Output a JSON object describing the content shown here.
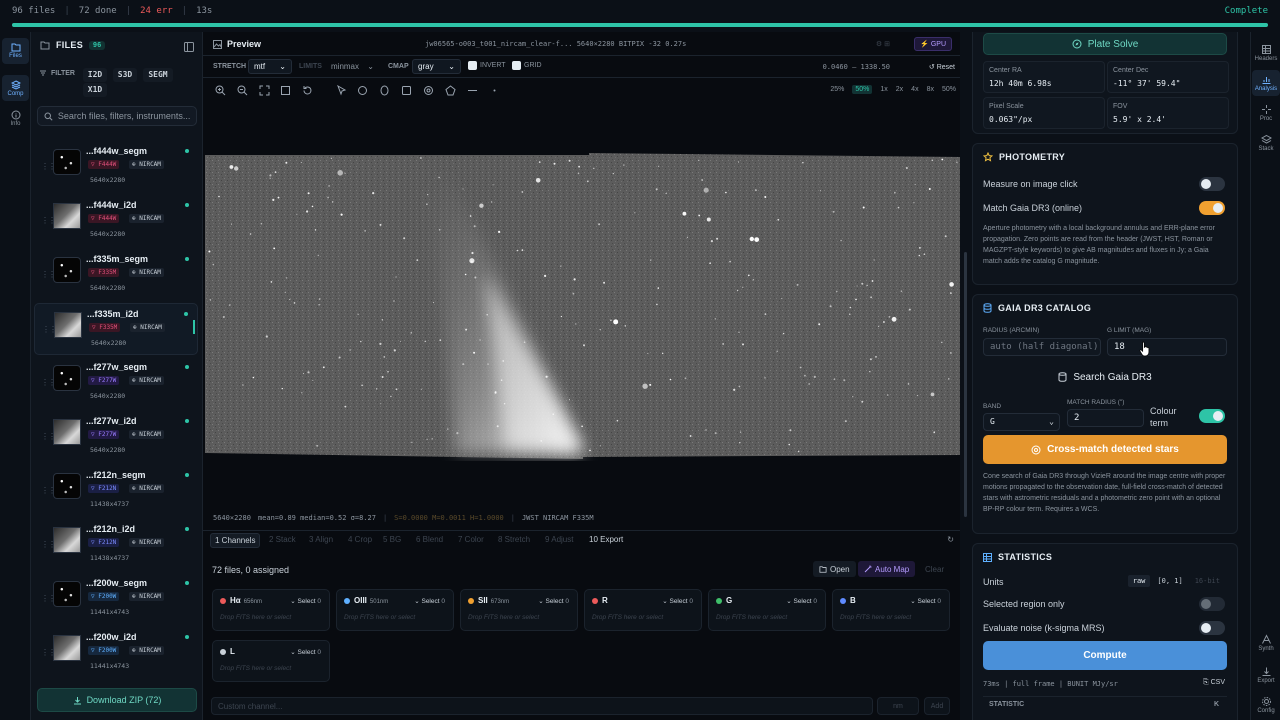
{
  "topbar": {
    "files": "96 files",
    "done": "72 done",
    "err": "24 err",
    "time": "13s",
    "status": "Complete",
    "progress": 1.0
  },
  "left_nav": [
    {
      "label": "Files",
      "icon": "folder-icon"
    },
    {
      "label": "Comp",
      "icon": "layers-icon"
    },
    {
      "label": "Info",
      "icon": "info-icon"
    }
  ],
  "files_panel": {
    "title": "FILES",
    "count": "96",
    "filter_label": "FILTER",
    "filters": [
      "I2D",
      "S3D",
      "SEGM",
      "X1D"
    ],
    "search_placeholder": "Search files, filters, instruments...",
    "items": [
      {
        "name": "...f444w_segm",
        "filter": "F444W",
        "instrument": "NIRCAM",
        "dims": "5640x2280",
        "thumb": "field",
        "color": "#e0507a",
        "bg": "#3a1624"
      },
      {
        "name": "...f444w_i2d",
        "filter": "F444W",
        "instrument": "NIRCAM",
        "dims": "5640x2280",
        "thumb": "smear",
        "color": "#e0507a",
        "bg": "#3a1624"
      },
      {
        "name": "...f335m_segm",
        "filter": "F335M",
        "instrument": "NIRCAM",
        "dims": "5640x2280",
        "thumb": "field",
        "color": "#e0507a",
        "bg": "#3a1624"
      },
      {
        "name": "...f335m_i2d",
        "filter": "F335M",
        "instrument": "NIRCAM",
        "dims": "5640x2280",
        "thumb": "smear",
        "color": "#e0507a",
        "bg": "#3a1624"
      },
      {
        "name": "...f277w_segm",
        "filter": "F277W",
        "instrument": "NIRCAM",
        "dims": "5640x2280",
        "thumb": "field",
        "color": "#9a7bff",
        "bg": "#221a44"
      },
      {
        "name": "...f277w_i2d",
        "filter": "F277W",
        "instrument": "NIRCAM",
        "dims": "5640x2280",
        "thumb": "smear",
        "color": "#9a7bff",
        "bg": "#221a44"
      },
      {
        "name": "...f212n_segm",
        "filter": "F212N",
        "instrument": "NIRCAM",
        "dims": "11438x4737",
        "thumb": "field",
        "color": "#7b8bff",
        "bg": "#1a1f44"
      },
      {
        "name": "...f212n_i2d",
        "filter": "F212N",
        "instrument": "NIRCAM",
        "dims": "11438x4737",
        "thumb": "smear",
        "color": "#7b8bff",
        "bg": "#1a1f44"
      },
      {
        "name": "...f200w_segm",
        "filter": "F200W",
        "instrument": "NIRCAM",
        "dims": "11441x4743",
        "thumb": "field",
        "color": "#5fb0ff",
        "bg": "#16283e"
      },
      {
        "name": "...f200w_i2d",
        "filter": "F200W",
        "instrument": "NIRCAM",
        "dims": "11441x4743",
        "thumb": "smear",
        "color": "#5fb0ff",
        "bg": "#16283e"
      }
    ],
    "download": "Download ZIP (72)"
  },
  "preview": {
    "title": "Preview",
    "filename": "jw06565-o003_t001_nircam_clear-f...  5640×2280  BITPIX -32  0.27s",
    "gpu": "GPU",
    "stretch_label": "STRETCH",
    "stretch": "mtf",
    "limits_label": "LIMITS",
    "limits": "minmax",
    "cmap_label": "CMAP",
    "cmap": "gray",
    "invert": "INVERT",
    "grid": "GRID",
    "range": "0.0460 – 1338.50",
    "reset": "Reset",
    "zoom_levels": [
      "25%",
      "50%",
      "1x",
      "2x",
      "4x",
      "8x",
      "50%"
    ],
    "status": {
      "dims": "5640×2280",
      "stats": "mean=0.89 median=0.52 σ=8.27",
      "levels": "S=0.0000 M=0.0011 H=1.0000",
      "meta": "JWST NIRCAM F335M"
    }
  },
  "compose": {
    "tabs": [
      "1 Channels",
      "2 Stack",
      "3 Align",
      "4 Crop",
      "5 BG",
      "6 Blend",
      "7 Color",
      "8 Stretch",
      "9 Adjust",
      "10 Export"
    ],
    "assigned": "72 files, 0 assigned",
    "open": "Open",
    "auto_map": "Auto Map",
    "clear": "Clear",
    "channels": [
      {
        "name": "Hα",
        "wl": "656nm",
        "color": "#ec5a5a"
      },
      {
        "name": "OIII",
        "wl": "501nm",
        "color": "#5fb0ff"
      },
      {
        "name": "SII",
        "wl": "673nm",
        "color": "#f0a030"
      },
      {
        "name": "R",
        "wl": "",
        "color": "#ec5a5a"
      },
      {
        "name": "G",
        "wl": "",
        "color": "#3fbf6a"
      },
      {
        "name": "B",
        "wl": "",
        "color": "#5f8bff"
      },
      {
        "name": "L",
        "wl": "",
        "color": "#c9d1d9"
      }
    ],
    "select": "Select",
    "select_count": "0",
    "drop": "Drop FITS here or select",
    "custom_placeholder": "Custom channel...",
    "nm": "nm",
    "add": "Add"
  },
  "plate": {
    "button": "Plate Solve",
    "center_ra_label": "Center RA",
    "center_ra": "12h 40m 6.98s",
    "center_dec_label": "Center Dec",
    "center_dec": "-11° 37' 59.4\"",
    "pixel_scale_label": "Pixel Scale",
    "pixel_scale": "0.063\"/px",
    "fov_label": "FOV",
    "fov": "5.9' x 2.4'"
  },
  "photometry": {
    "title": "PHOTOMETRY",
    "measure": "Measure on image click",
    "match": "Match Gaia DR3 (online)",
    "desc": "Aperture photometry with a local background annulus and ERR-plane error propagation. Zero points are read from the header (JWST, HST, Roman or MAGZPT-style keywords) to give AB magnitudes and fluxes in Jy; a Gaia match adds the catalog G magnitude."
  },
  "gaia": {
    "title": "GAIA DR3 CATALOG",
    "radius_label": "RADIUS (ARCMIN)",
    "radius_placeholder": "auto (half diagonal)",
    "glimit_label": "G LIMIT (MAG)",
    "glimit": "18",
    "search": "Search Gaia DR3",
    "band_label": "BAND",
    "band": "G",
    "match_label": "MATCH RADIUS (\")",
    "match": "2",
    "colour_term": "Colour term",
    "crossmatch": "Cross-match detected stars",
    "desc": "Cone search of Gaia DR3 through VizieR around the image centre with proper motions propagated to the observation date, full-field cross-match of detected stars with astrometric residuals and a photometric zero point with an optional BP-RP colour term. Requires a WCS."
  },
  "statistics": {
    "title": "STATISTICS",
    "units": "Units",
    "unit_opts": [
      "raw",
      "[0, 1]",
      "16-bit"
    ],
    "region": "Selected region only",
    "noise": "Evaluate noise (k-sigma MRS)",
    "compute": "Compute",
    "meta": "73ms | full frame | BUNIT MJy/sr",
    "csv": "CSV",
    "col_stat": "STATISTIC",
    "col_k": "K"
  },
  "right_nav": [
    {
      "label": "Headers",
      "icon": "table-icon"
    },
    {
      "label": "Analysis",
      "icon": "chart-icon"
    },
    {
      "label": "Proc",
      "icon": "sparkle-icon"
    },
    {
      "label": "Stack",
      "icon": "stack-icon"
    },
    {
      "label": "Synth",
      "icon": "synth-icon"
    },
    {
      "label": "Export",
      "icon": "export-icon"
    },
    {
      "label": "Config",
      "icon": "gear-icon"
    }
  ]
}
